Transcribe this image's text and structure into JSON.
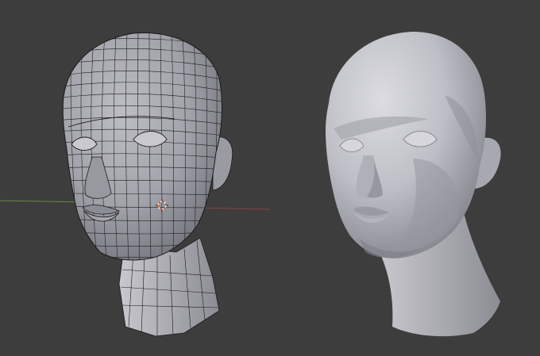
{
  "viewport": {
    "background": "#3d3d3d",
    "axis_colors": {
      "x_axis": "#9a3a3a",
      "y_axis": "#5f8f3a"
    },
    "wireframe_model": {
      "mode": "edit-wireframe",
      "color": "#a4a4ac",
      "edge_color": "#1a1a1a"
    },
    "shaded_model": {
      "mode": "solid-shaded",
      "color": "#c2c2ca"
    },
    "cursor_color": "#d05a2a"
  }
}
